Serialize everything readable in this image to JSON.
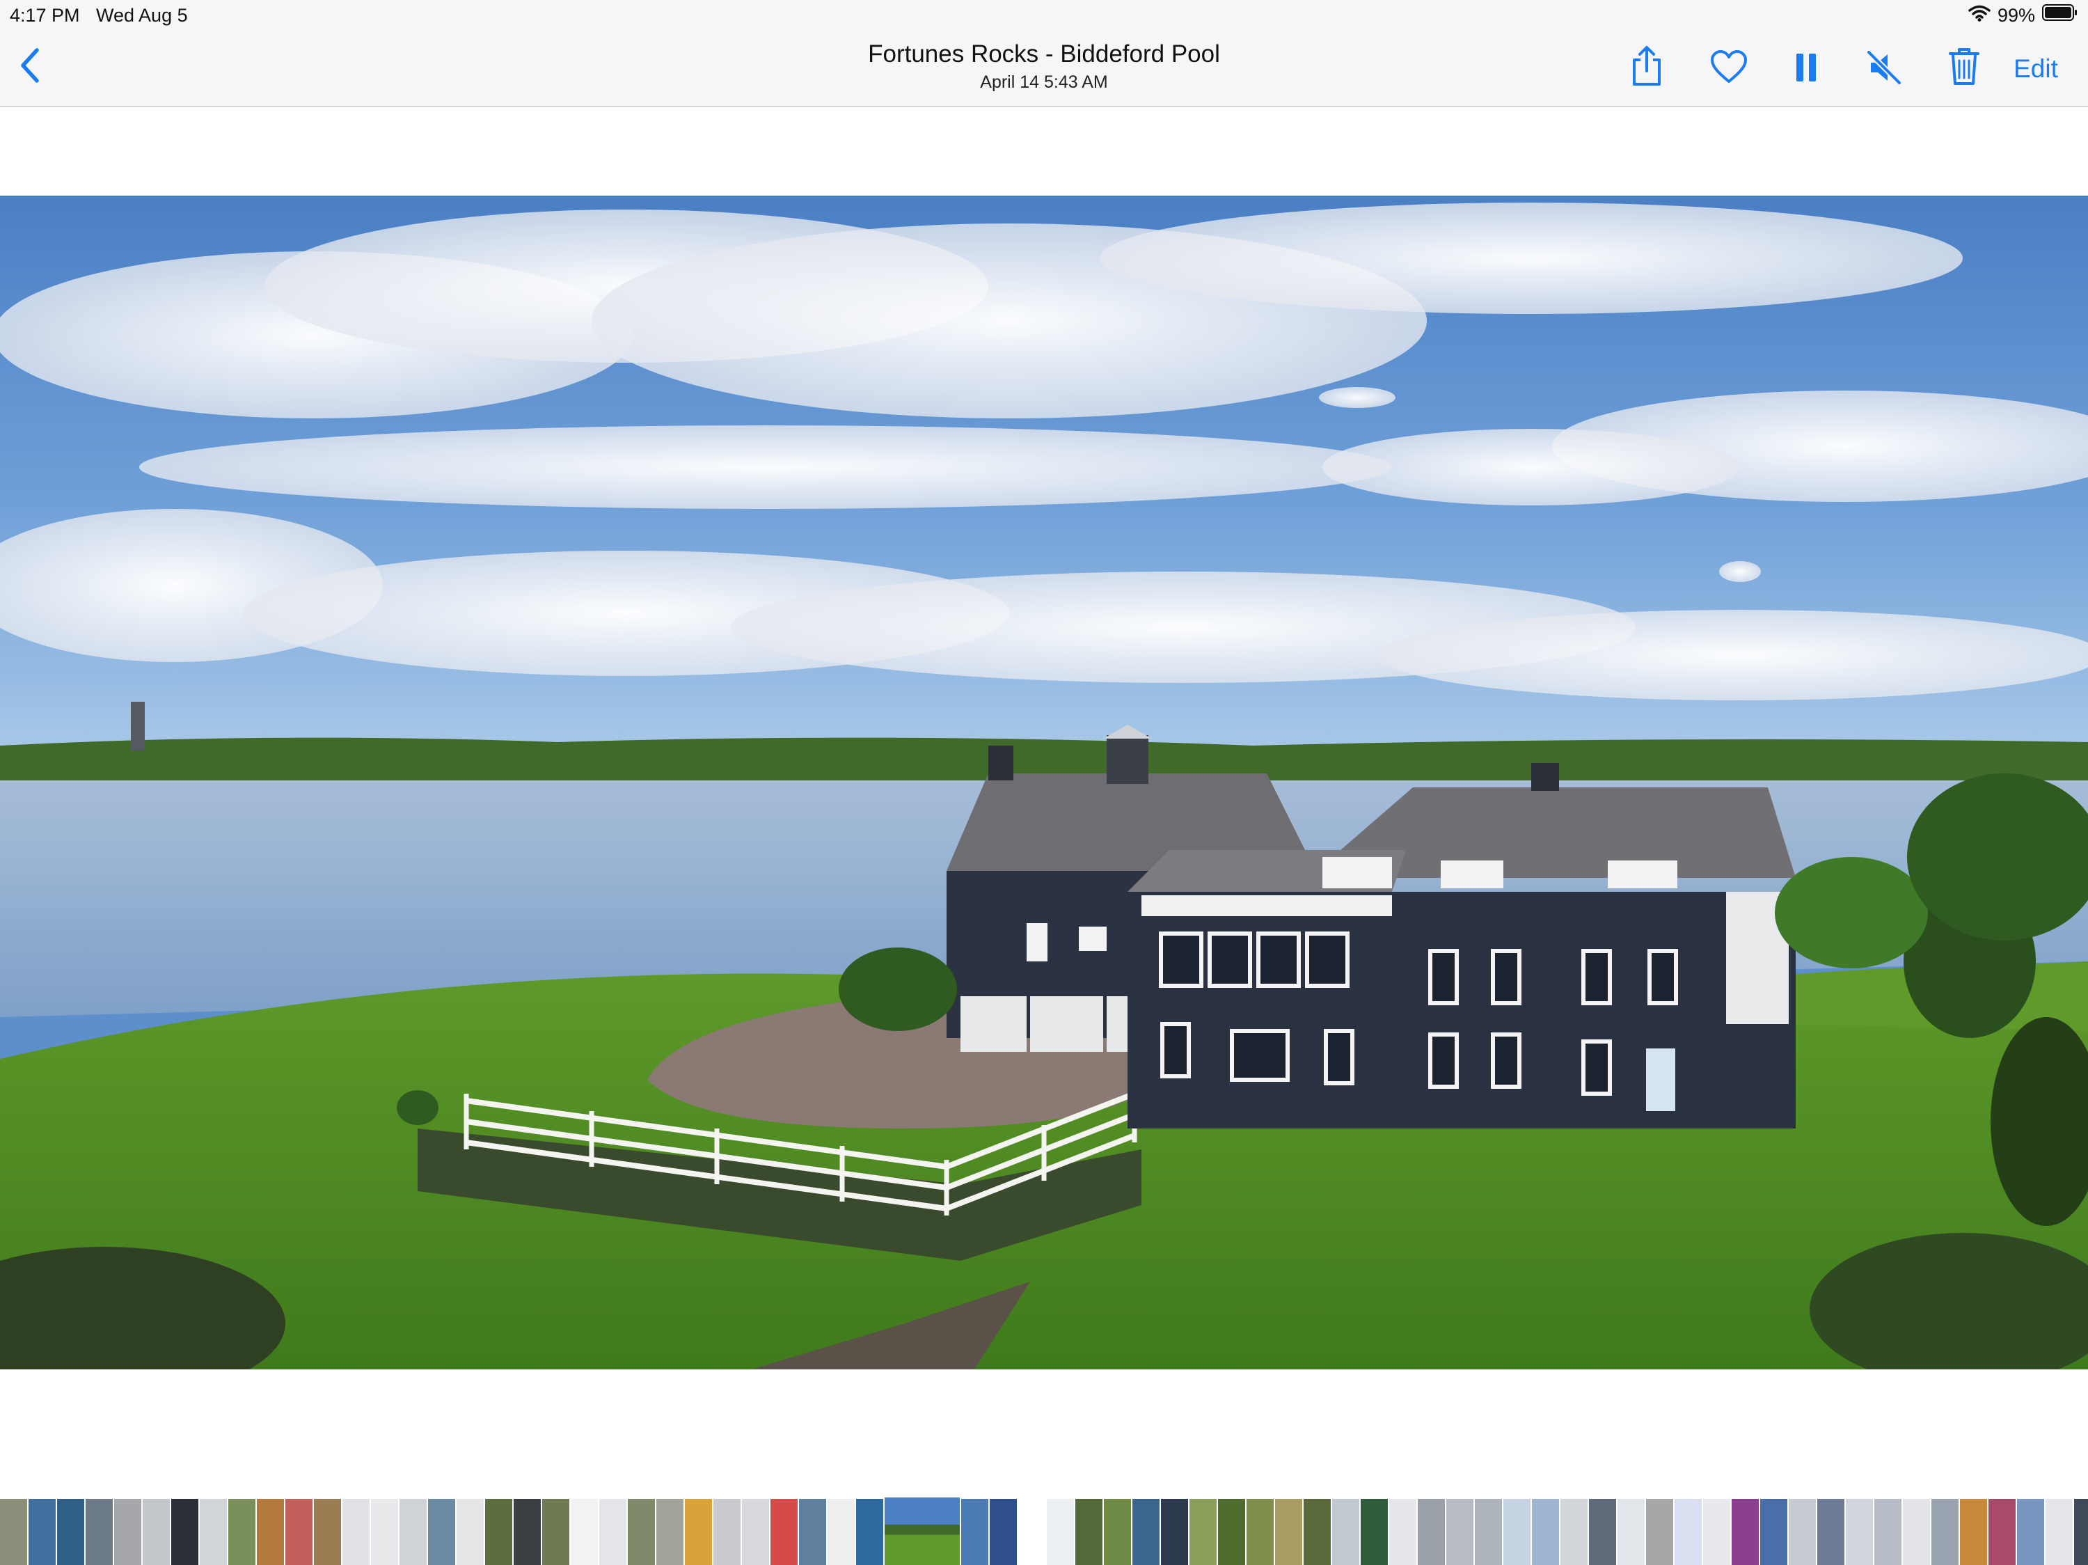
{
  "status_bar": {
    "time": "4:17 PM",
    "date": "Wed Aug 5",
    "battery_percent": "99%"
  },
  "nav": {
    "title": "Fortunes Rocks - Biddeford Pool",
    "subtitle": "April 14  5:43 AM",
    "edit_label": "Edit"
  },
  "icons": {
    "back": "chevron-left-icon",
    "share": "share-icon",
    "favorite": "heart-icon",
    "pause": "pause-icon",
    "mute": "speaker-muted-icon",
    "delete": "trash-icon"
  },
  "colors": {
    "accent": "#1a7cf0",
    "bar_background": "#f6f6f6"
  },
  "filmstrip": {
    "thumb_colors": [
      "#8a8f7a",
      "#3f6f9e",
      "#2f5f86",
      "#6c7a88",
      "#a6a7ab",
      "#c3c7cb",
      "#2a2f38",
      "#d1d4d8",
      "#7b8f5a",
      "#b47a3c",
      "#c25f5a",
      "#9a7d52",
      "#dfe1e4",
      "#e8e9eb",
      "#cfd2d6",
      "#6d8aa3",
      "#e5e6e8",
      "#5c6e3f",
      "#3b3f44",
      "#6f7a55",
      "#f2f2f2",
      "#e3e5e8",
      "#7f8a6a",
      "#a3a39a",
      "#d8a33a",
      "#c9cbd0",
      "#d7d9dc",
      "#d64a4a",
      "#5f7f9e",
      "#eeeeee",
      "#2e6a9c",
      "#3c6fa3",
      "#4a7bb5",
      "#2f4f8a",
      "#ffffff",
      "#edf0f2",
      "#556a3a",
      "#6f8a45",
      "#3a6690",
      "#2d3a4d",
      "#8aa05a",
      "#4f6b2e",
      "#7f8f4a",
      "#a99c62",
      "#5b6a3c",
      "#c2c9d1",
      "#2f5c3a",
      "#e6e7ea",
      "#9aa0a8",
      "#b8bcc2",
      "#aeb4bb",
      "#c6d3e3",
      "#9fb4cf",
      "#d2d5da",
      "#5f6b7a",
      "#e3e6ea",
      "#a7a7a7",
      "#d9def0",
      "#e7e9ec",
      "#8c3f8e",
      "#4a6fa8",
      "#c7cbd2",
      "#6d7b95",
      "#d2d6dc",
      "#b5bcc8",
      "#e2e4e8",
      "#9aa3b0",
      "#c88a3a",
      "#a84a6a",
      "#7a96c0",
      "#e4e6e9",
      "#3f4a58",
      "#f0f1f3"
    ]
  }
}
